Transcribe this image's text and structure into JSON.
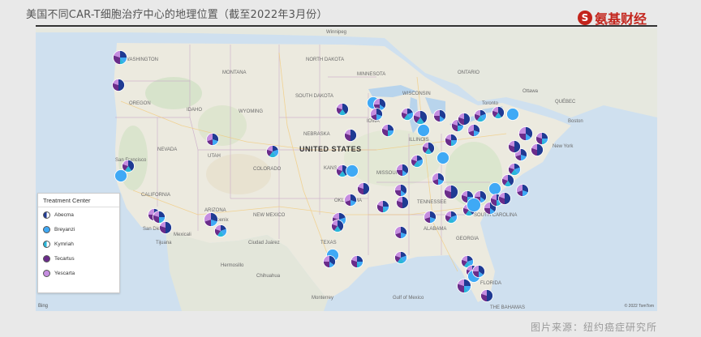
{
  "header": {
    "title": "美国不同CAR-T细胞治疗中心的地理位置（截至2022年3月份）",
    "logo_mark": "S",
    "logo_text": "氨基财经"
  },
  "map": {
    "country_label": "UNITED STATES",
    "labels": {
      "winnipeg": "Winnipeg",
      "washington": "WASHINGTON",
      "oregon": "OREGON",
      "idaho": "IDAHO",
      "montana": "MONTANA",
      "north_dakota": "NORTH DAKOTA",
      "south_dakota": "SOUTH DAKOTA",
      "wyoming": "WYOMING",
      "nevada": "NEVADA",
      "colorado": "COLORADO",
      "utah": "UTAH",
      "california": "CALIFORNIA",
      "arizona": "ARIZONA",
      "new_mexico": "NEW MEXICO",
      "texas": "TEXAS",
      "oklahoma": "OKLAHOMA",
      "kansas": "KANSAS",
      "nebraska": "NEBRASKA",
      "iowa": "IOWA",
      "minnesota": "MINNESOTA",
      "wisconsin": "WISCONSIN",
      "missouri": "MISSOURI",
      "illinois": "ILLINOIS",
      "tennessee": "TENNESSEE",
      "georgia": "GEORGIA",
      "alabama": "ALABAMA",
      "south_carolina": "SOUTH CAROLINA",
      "florida": "FLORIDA",
      "ottawa": "Ottawa",
      "quebec": "QUÉBEC",
      "toronto": "Toronto",
      "new_york": "New York",
      "boston": "Boston",
      "hermosillo": "Hermosillo",
      "chihuahua": "Chihuahua",
      "ciudad_juarez": "Ciudad Juárez",
      "phoenix": "Phoenix",
      "san_diego": "San Diego",
      "mexicali": "Mexicali",
      "monterrey": "Monterrey",
      "gulf_of_mexico": "Gulf of Mexico",
      "the_bahamas": "THE BAHAMAS",
      "ontario": "ONTARIO",
      "san_francisco": "San Francisco",
      "tijuana": "Tijuana"
    },
    "bing": "Bing",
    "copyright": "© 2022 TomTom"
  },
  "legend": {
    "title": "Treatment Center",
    "items": [
      {
        "label": "Abecma",
        "color": "#1f3a93"
      },
      {
        "label": "Breyanzi",
        "color": "#3fa9f5"
      },
      {
        "label": "Kymriah",
        "color": "#29b6d9"
      },
      {
        "label": "Tecartus",
        "color": "#6a2c8a"
      },
      {
        "label": "Yescarta",
        "color": "#c58de0"
      }
    ]
  },
  "source": "图片来源：纽约癌症研究所"
}
